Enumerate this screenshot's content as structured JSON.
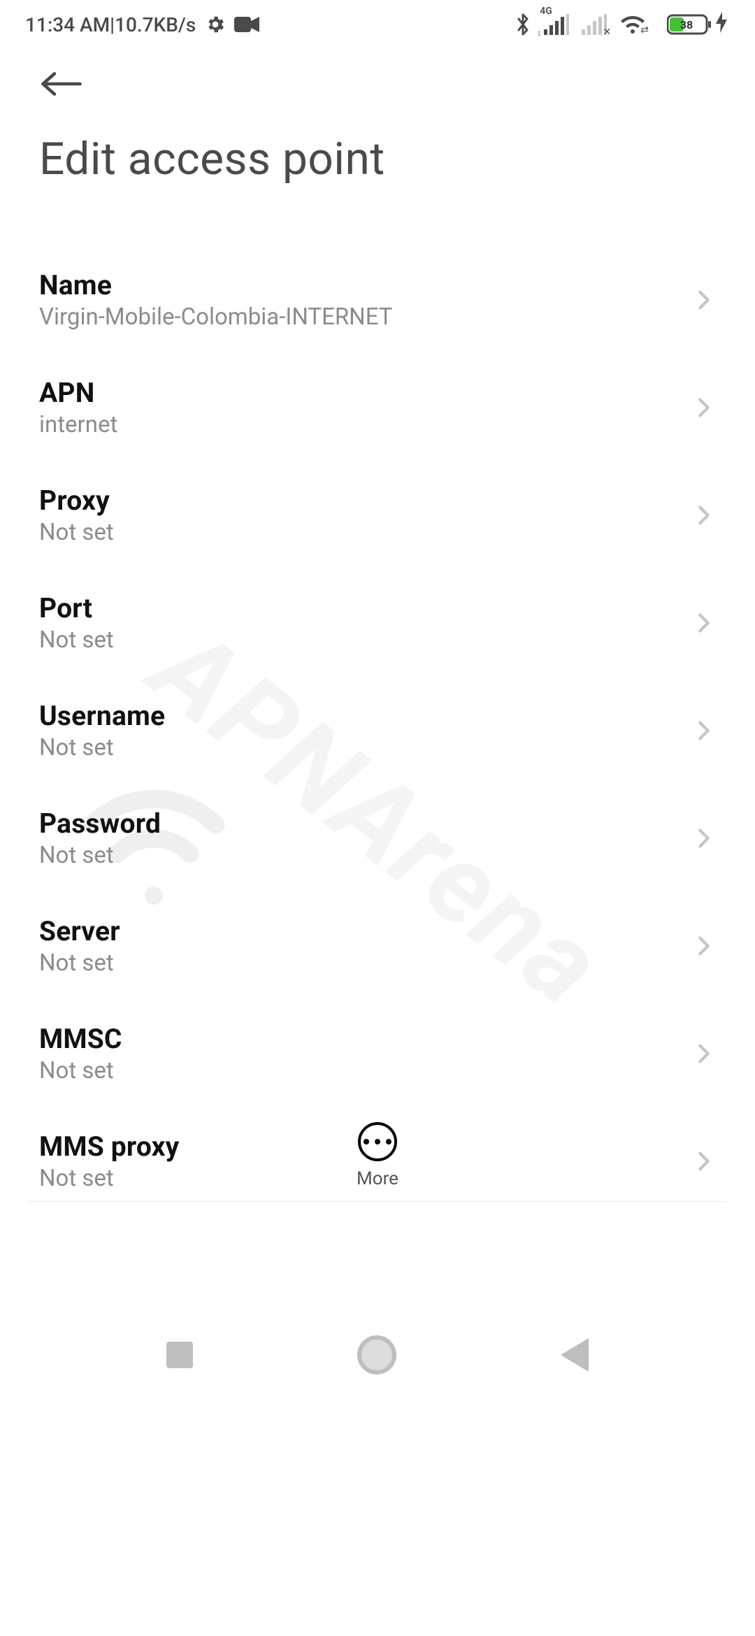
{
  "status_bar": {
    "time": "11:34 AM",
    "separator": " | ",
    "speed": "10.7KB/s",
    "net_label_4g": "4G",
    "battery_percent": "38"
  },
  "header": {
    "title": "Edit access point"
  },
  "settings": [
    {
      "key": "name",
      "title": "Name",
      "value": "Virgin-Mobile-Colombia-INTERNET"
    },
    {
      "key": "apn",
      "title": "APN",
      "value": "internet"
    },
    {
      "key": "proxy",
      "title": "Proxy",
      "value": "Not set"
    },
    {
      "key": "port",
      "title": "Port",
      "value": "Not set"
    },
    {
      "key": "username",
      "title": "Username",
      "value": "Not set"
    },
    {
      "key": "password",
      "title": "Password",
      "value": "Not set"
    },
    {
      "key": "server",
      "title": "Server",
      "value": "Not set"
    },
    {
      "key": "mmsc",
      "title": "MMSC",
      "value": "Not set"
    },
    {
      "key": "mms_proxy",
      "title": "MMS proxy",
      "value": "Not set"
    }
  ],
  "more_button": {
    "label": "More"
  },
  "watermark": "APNArena"
}
